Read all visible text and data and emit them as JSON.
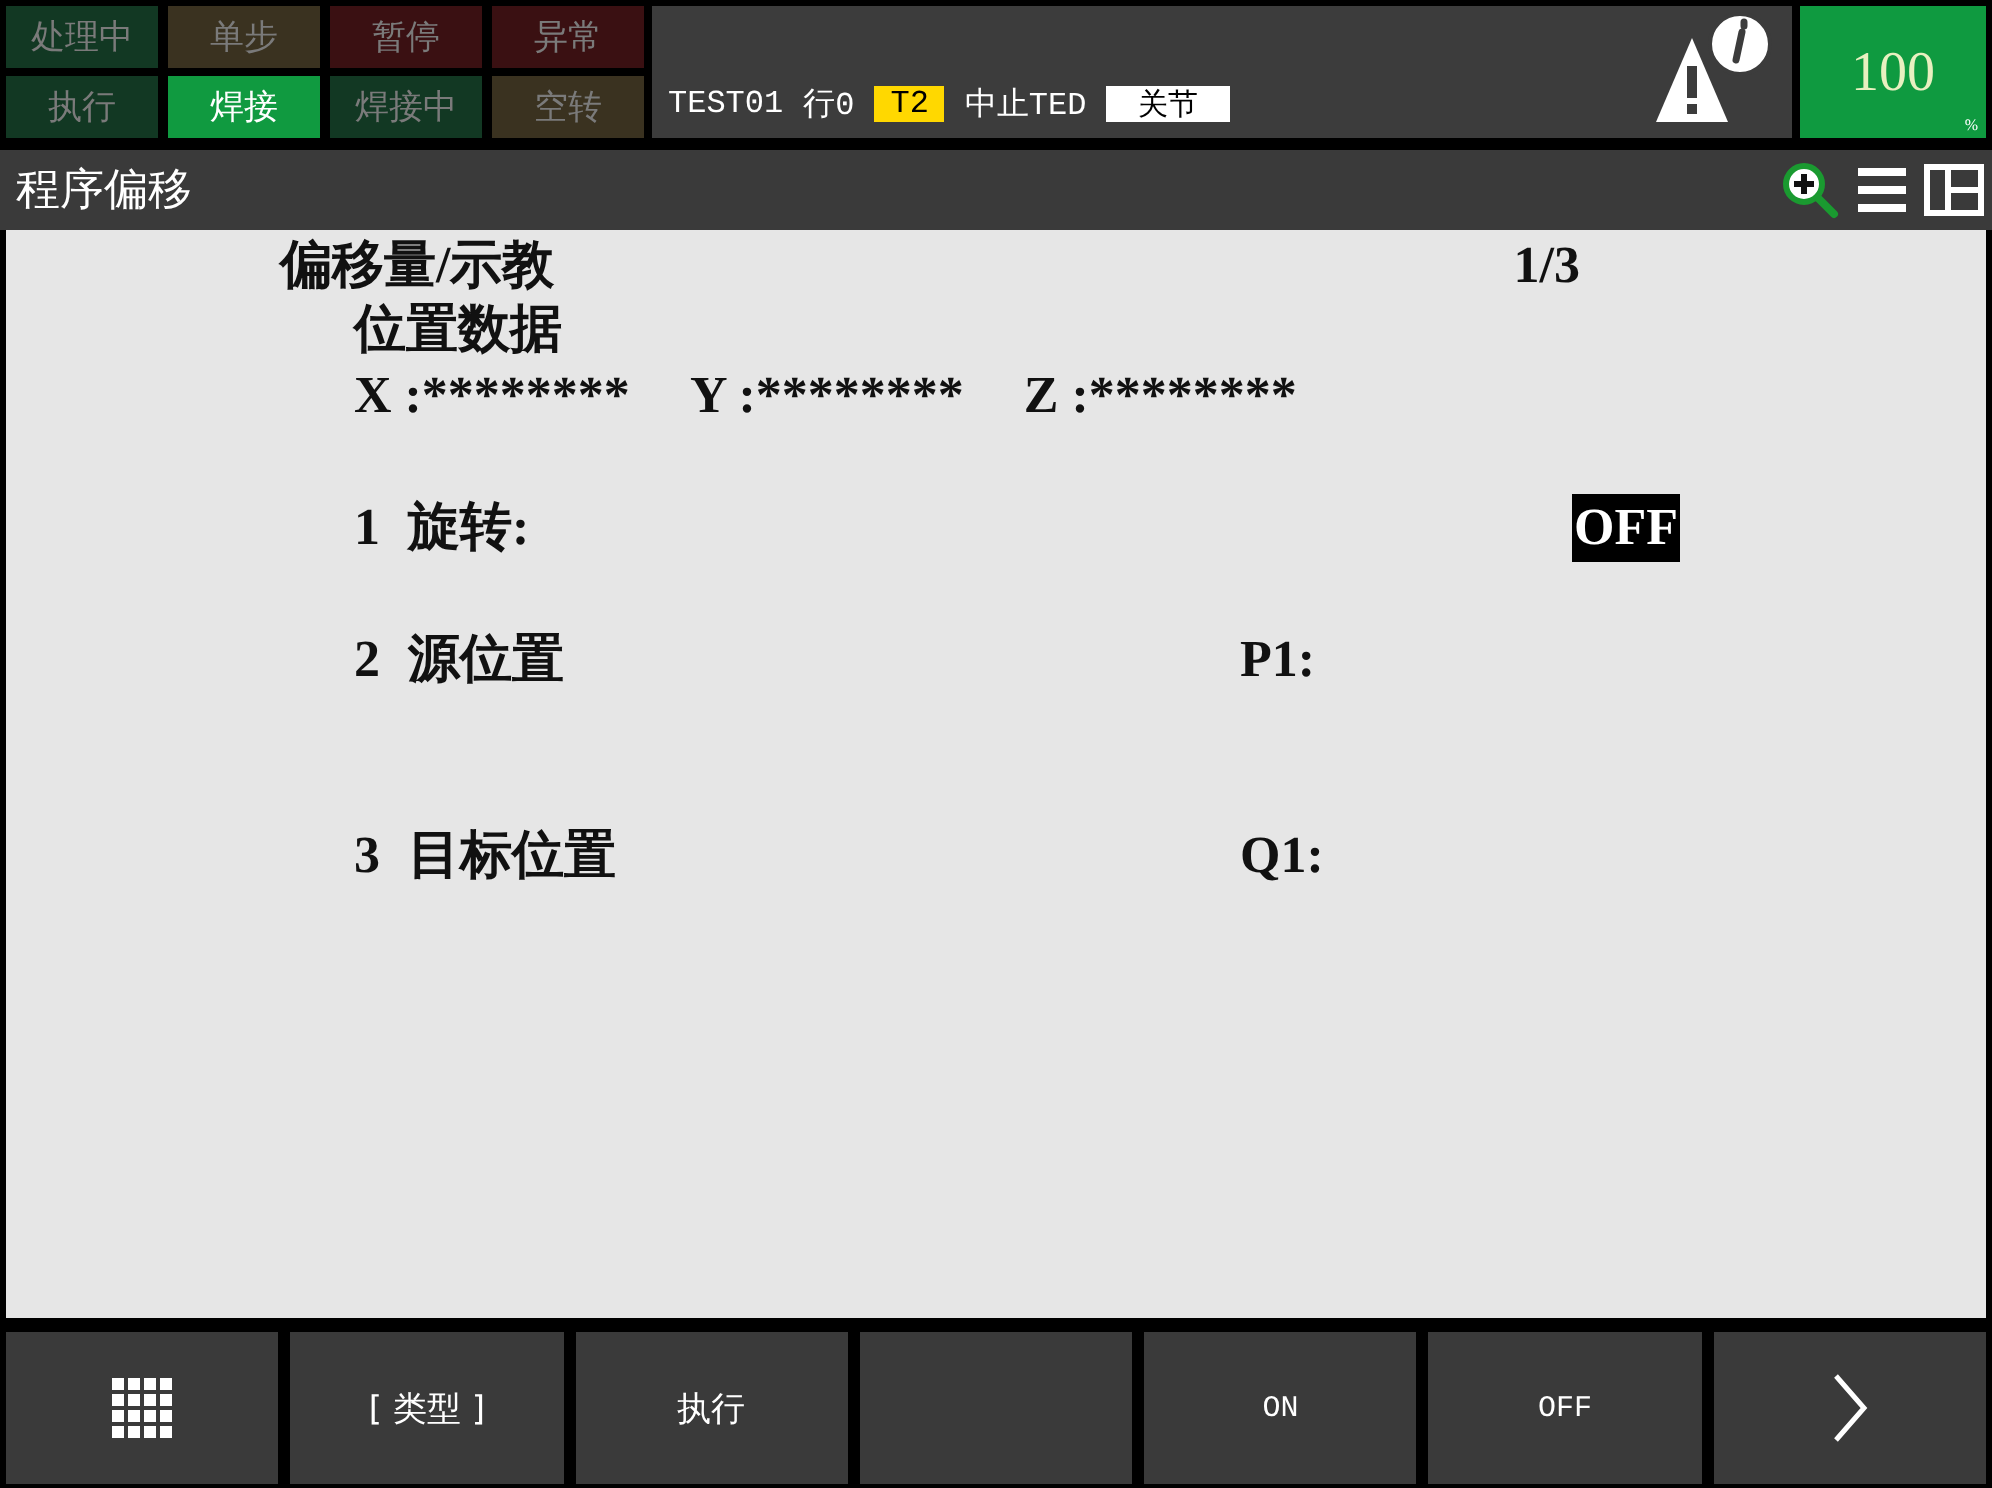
{
  "status_lights": [
    {
      "label": "处理中",
      "on": false,
      "color": "#123823"
    },
    {
      "label": "单步",
      "on": false,
      "color": "#3a3220"
    },
    {
      "label": "暂停",
      "on": false,
      "color": "#3a1012"
    },
    {
      "label": "异常",
      "on": false,
      "color": "#3a1012"
    },
    {
      "label": "执行",
      "on": false,
      "color": "#123823"
    },
    {
      "label": "焊接",
      "on": true,
      "color": "#109a40"
    },
    {
      "label": "焊接中",
      "on": false,
      "color": "#123823"
    },
    {
      "label": "空转",
      "on": false,
      "color": "#3a3220"
    }
  ],
  "status": {
    "program": "TEST01",
    "line": "行0",
    "mode": "T2",
    "state": "中止TED",
    "joint": "关节"
  },
  "speed": {
    "value": "100",
    "unit": "%"
  },
  "title": "程序偏移",
  "header": {
    "title": "偏移量/示教",
    "page": "1/3"
  },
  "position_data": {
    "label": "位置数据",
    "coords": [
      "X :********",
      "Y :********",
      "Z :********"
    ]
  },
  "items": [
    {
      "number": "1",
      "label": "旋转:",
      "value": "OFF",
      "kind": "toggle",
      "selected": true
    },
    {
      "number": "2",
      "label": "源位置",
      "value": "P1:",
      "kind": "position",
      "selected": false
    },
    {
      "number": "3",
      "label": "目标位置",
      "value": "Q1:",
      "kind": "position",
      "selected": false
    }
  ],
  "function_keys": [
    {
      "kind": "grid"
    },
    {
      "kind": "text",
      "label": "[ 类型 ]"
    },
    {
      "kind": "text",
      "label": "执行"
    },
    {
      "kind": "empty"
    },
    {
      "kind": "text",
      "label": "ON"
    },
    {
      "kind": "text",
      "label": "OFF"
    },
    {
      "kind": "next"
    }
  ]
}
